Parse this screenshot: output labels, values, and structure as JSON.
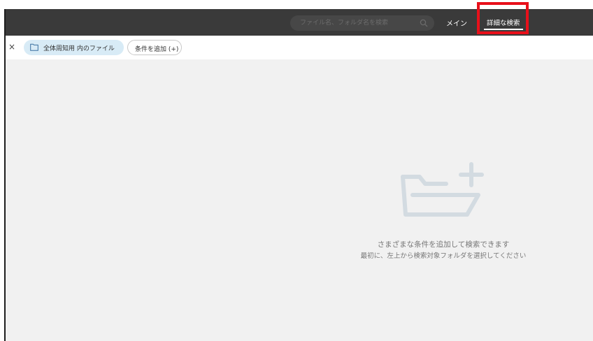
{
  "header": {
    "search_placeholder": "ファイル名、フォルダ名を検索",
    "nav_main_label": "メイン",
    "nav_advanced_label": "詳細な検索"
  },
  "filter_bar": {
    "close_label": "×",
    "folder_chip_label": "全体周知用 内のファイル",
    "add_condition_label": "条件を追加 (+)"
  },
  "empty_state": {
    "line1": "さまざまな条件を追加して検索できます",
    "line2": "最初に、左上から検索対象フォルダを選択してください"
  },
  "colors": {
    "header_bg": "#3a3a3a",
    "highlight": "#e8101a",
    "folder_chip_bg": "#d8ebf6",
    "content_bg": "#f1f1f1"
  },
  "icons": {
    "search": "search-icon",
    "folder": "folder-icon",
    "empty_folder": "folder-plus-icon"
  }
}
